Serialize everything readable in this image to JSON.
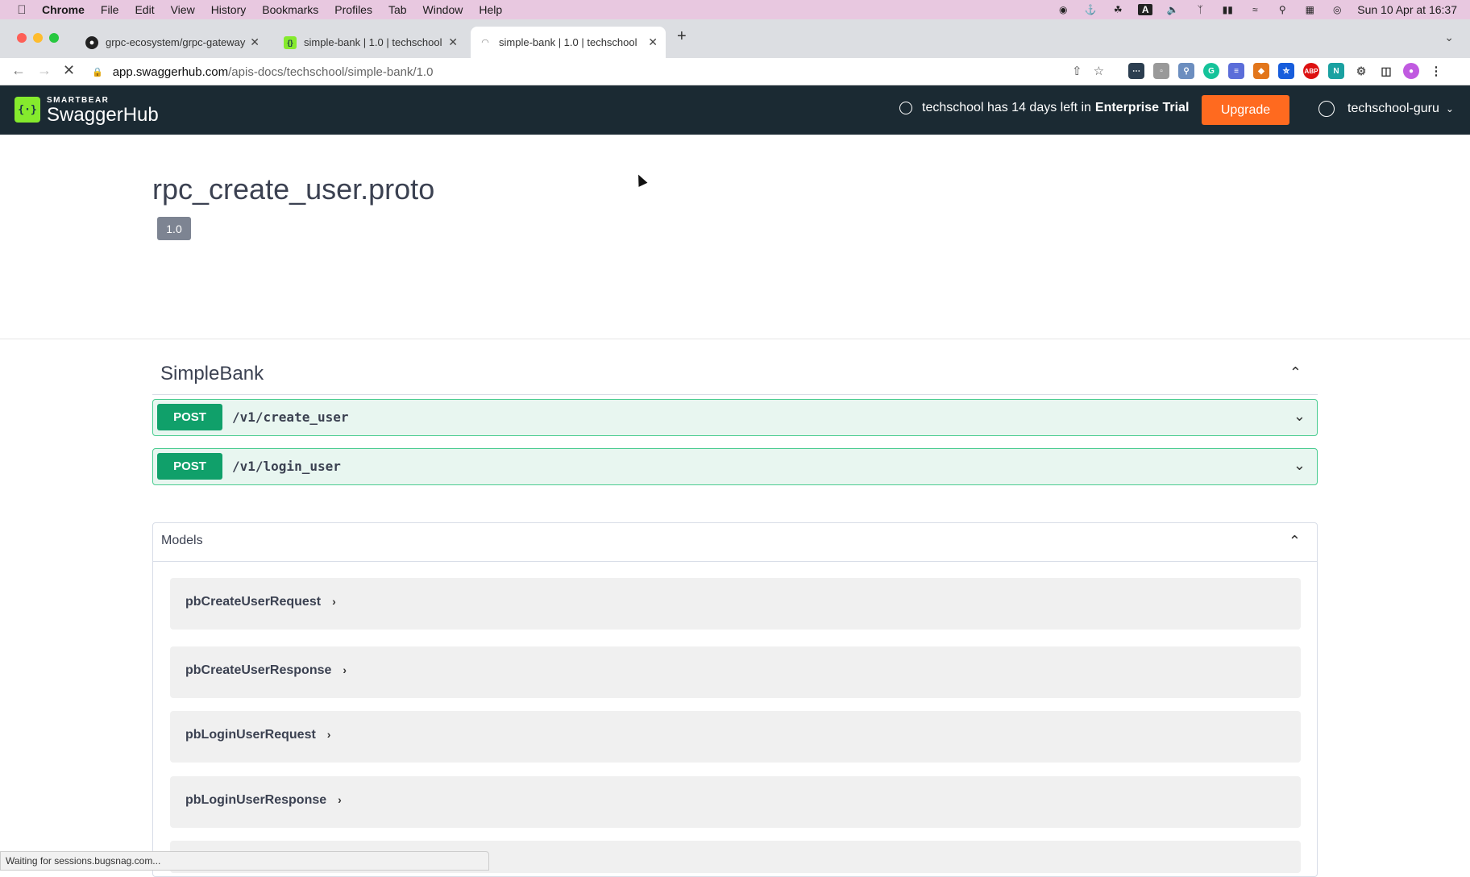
{
  "macos_menubar": {
    "app": "Chrome",
    "items": [
      "File",
      "Edit",
      "View",
      "History",
      "Bookmarks",
      "Profiles",
      "Tab",
      "Window",
      "Help"
    ],
    "clock": "Sun 10 Apr at  16:37"
  },
  "browser": {
    "tabs": [
      {
        "title": "grpc-ecosystem/grpc-gateway",
        "favicon": "github-icon"
      },
      {
        "title": "simple-bank | 1.0 | techschool",
        "favicon": "swaggerhub-icon"
      },
      {
        "title": "simple-bank | 1.0 | techschool",
        "favicon": "loading-icon",
        "active": true
      }
    ],
    "url_host": "app.swaggerhub.com",
    "url_path": "/apis-docs/techschool/simple-bank/1.0"
  },
  "header": {
    "logo_small": "SMARTBEAR",
    "logo_big": "SwaggerHub",
    "trial_prefix": "techschool has 14 days left in",
    "trial_plan": "Enterprise Trial",
    "upgrade_label": "Upgrade",
    "username": "techschool-guru"
  },
  "api": {
    "title": "rpc_create_user.proto",
    "version": "1.0"
  },
  "tag": {
    "name": "SimpleBank"
  },
  "operations": [
    {
      "method": "POST",
      "path": "/v1/create_user"
    },
    {
      "method": "POST",
      "path": "/v1/login_user"
    }
  ],
  "models": {
    "title": "Models",
    "items": [
      "pbCreateUserRequest",
      "pbCreateUserResponse",
      "pbLoginUserRequest",
      "pbLoginUserResponse"
    ]
  },
  "status_text": "Waiting for sessions.bugsnag.com...",
  "colors": {
    "header_bg": "#1b2a33",
    "upgrade": "#ff6a1f",
    "post_badge": "#10a06a",
    "post_row_bg": "#e8f6f0",
    "post_border": "#49cc90"
  }
}
